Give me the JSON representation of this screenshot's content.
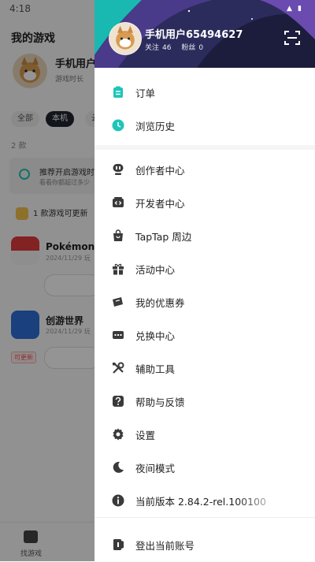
{
  "status_bar": {
    "time": "4:18"
  },
  "background": {
    "title": "我的游戏",
    "user_name": "手机用户",
    "user_sub": "游戏时长",
    "tabs": {
      "all": "全部",
      "local": "本机",
      "cloud": "云"
    },
    "count": "2 款",
    "recommend_title": "推荐开启游戏时",
    "recommend_sub": "看看你都超过多少",
    "update_text": "1 款游戏可更新",
    "games": [
      {
        "name": "Pokémon H",
        "date": "2024/11/29 玩"
      },
      {
        "name": "创游世界",
        "date": "2024/11/29 玩"
      }
    ],
    "update_tag": "可更新",
    "nav_label": "找游戏"
  },
  "drawer": {
    "header": {
      "user_name": "手机用户65494627",
      "follow_label": "关注",
      "follow_count": "46",
      "fans_label": "粉丝",
      "fans_count": "0"
    },
    "items": [
      {
        "label": "订单",
        "icon": "clipboard-icon"
      },
      {
        "label": "浏览历史",
        "icon": "clock-icon"
      },
      {
        "label": "创作者中心",
        "icon": "creator-icon"
      },
      {
        "label": "开发者中心",
        "icon": "code-icon"
      },
      {
        "label": "TapTap 周边",
        "icon": "shopping-bag-icon"
      },
      {
        "label": "活动中心",
        "icon": "gift-icon"
      },
      {
        "label": "我的优惠券",
        "icon": "coupon-icon"
      },
      {
        "label": "兑换中心",
        "icon": "card-icon"
      },
      {
        "label": "辅助工具",
        "icon": "tools-icon"
      },
      {
        "label": "帮助与反馈",
        "icon": "help-icon"
      },
      {
        "label": "设置",
        "icon": "gear-icon"
      },
      {
        "label": "夜间模式",
        "icon": "moon-icon"
      },
      {
        "label": "当前版本 2.84.2-rel.100100",
        "icon": "info-icon"
      },
      {
        "label": "登出当前账号",
        "icon": "logout-icon"
      }
    ]
  },
  "colors": {
    "accent": "#1ec5b8",
    "icon_gray": "#3a3a3a",
    "header_bg": "#1c1d3c"
  }
}
